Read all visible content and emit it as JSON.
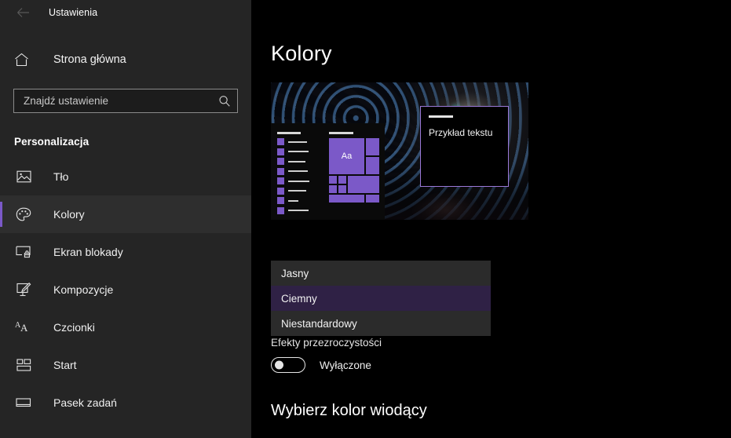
{
  "window": {
    "title": "Ustawienia",
    "back_icon": "back-arrow-icon"
  },
  "sidebar": {
    "home": {
      "label": "Strona główna",
      "icon": "home-icon"
    },
    "search": {
      "value": "",
      "placeholder": "Znajdź ustawienie",
      "icon": "search-icon"
    },
    "section_title": "Personalizacja",
    "items": [
      {
        "label": "Tło",
        "icon": "picture-icon",
        "selected": false
      },
      {
        "label": "Kolory",
        "icon": "palette-icon",
        "selected": true
      },
      {
        "label": "Ekran blokady",
        "icon": "lock-screen-icon",
        "selected": false
      },
      {
        "label": "Kompozycje",
        "icon": "theme-brush-icon",
        "selected": false
      },
      {
        "label": "Czcionki",
        "icon": "fonts-icon",
        "selected": false
      },
      {
        "label": "Start",
        "icon": "start-tiles-icon",
        "selected": false
      },
      {
        "label": "Pasek zadań",
        "icon": "taskbar-icon",
        "selected": false
      }
    ]
  },
  "main": {
    "page_title": "Kolory",
    "preview": {
      "tile_text": "Aa",
      "sample_window_text": "Przykład tekstu"
    },
    "dropdown": {
      "options": [
        {
          "label": "Jasny",
          "selected": false
        },
        {
          "label": "Ciemny",
          "selected": true
        },
        {
          "label": "Niestandardowy",
          "selected": false
        }
      ]
    },
    "transparency": {
      "label": "Efekty przezroczystości",
      "toggle_state": "Wyłączone",
      "toggle_on": false
    },
    "accent_heading": "Wybierz kolor wiodący"
  },
  "colors": {
    "accent": "#7b59c8",
    "sidebar_bg": "#252525",
    "main_bg": "#000000",
    "dropdown_bg": "#2b2b2b",
    "dropdown_selected_bg": "#2f2145",
    "text": "#f2f2f2"
  }
}
